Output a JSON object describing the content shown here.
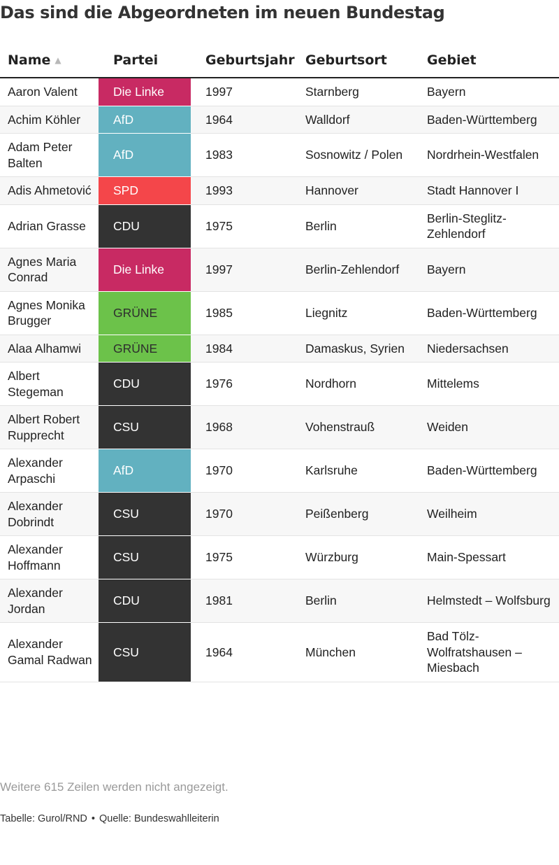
{
  "title": "Das sind die Abgeordneten im neuen Bundestag",
  "columns": {
    "name": "Name",
    "party": "Partei",
    "year": "Geburtsjahr",
    "place": "Geburtsort",
    "area": "Gebiet",
    "sort_icon": "sort-ascending-icon"
  },
  "party_colors": {
    "Die Linke": "#c82a63",
    "AfD": "#62b1c0",
    "SPD": "#f4464a",
    "CDU": "#333333",
    "CSU": "#333333",
    "GRÜNE": "#6cc24a"
  },
  "party_text_colors": {
    "Die Linke": "#ffffff",
    "AfD": "#ffffff",
    "SPD": "#ffffff",
    "CDU": "#ffffff",
    "CSU": "#ffffff",
    "GRÜNE": "#2e2e2e"
  },
  "rows": [
    {
      "name": "Aaron Valent",
      "party": "Die Linke",
      "year": "1997",
      "place": "Starnberg",
      "area": "Bayern"
    },
    {
      "name": "Achim Köhler",
      "party": "AfD",
      "year": "1964",
      "place": "Walldorf",
      "area": "Baden-Württemberg"
    },
    {
      "name": "Adam Peter Balten",
      "party": "AfD",
      "year": "1983",
      "place": "Sosnowitz / Polen",
      "area": "Nordrhein-Westfalen"
    },
    {
      "name": "Adis Ahmetović",
      "party": "SPD",
      "year": "1993",
      "place": "Hannover",
      "area": "Stadt Hannover I"
    },
    {
      "name": "Adrian Grasse",
      "party": "CDU",
      "year": "1975",
      "place": "Berlin",
      "area": "Berlin-Steglitz-Zehlendorf"
    },
    {
      "name": "Agnes Maria Conrad",
      "party": "Die Linke",
      "year": "1997",
      "place": "Berlin-Zehlendorf",
      "area": "Bayern"
    },
    {
      "name": "Agnes Monika Brugger",
      "party": "GRÜNE",
      "year": "1985",
      "place": "Liegnitz",
      "area": "Baden-Württemberg"
    },
    {
      "name": "Alaa Alhamwi",
      "party": "GRÜNE",
      "year": "1984",
      "place": "Damaskus, Syrien",
      "area": "Niedersachsen"
    },
    {
      "name": "Albert Stegeman",
      "party": "CDU",
      "year": "1976",
      "place": "Nordhorn",
      "area": "Mittelems"
    },
    {
      "name": "Albert Robert Rupprecht",
      "party": "CSU",
      "year": "1968",
      "place": "Vohenstrauß",
      "area": "Weiden"
    },
    {
      "name": "Alexander Arpaschi",
      "party": "AfD",
      "year": "1970",
      "place": "Karlsruhe",
      "area": "Baden-Württemberg"
    },
    {
      "name": "Alexander Dobrindt",
      "party": "CSU",
      "year": "1970",
      "place": "Peißenberg",
      "area": "Weilheim"
    },
    {
      "name": "Alexander Hoffmann",
      "party": "CSU",
      "year": "1975",
      "place": "Würzburg",
      "area": "Main-Spessart"
    },
    {
      "name": "Alexander Jordan",
      "party": "CDU",
      "year": "1981",
      "place": "Berlin",
      "area": "Helmstedt – Wolfsburg"
    },
    {
      "name": "Alexander Gamal Radwan",
      "party": "CSU",
      "year": "1964",
      "place": "München",
      "area": "Bad Tölz-Wolfratshausen – Miesbach"
    }
  ],
  "footer_note": "Weitere 615 Zeilen werden nicht angezeigt.",
  "source": {
    "table": "Tabelle: Gurol/RND",
    "separator": "•",
    "origin": "Quelle: Bundeswahlleiterin"
  }
}
